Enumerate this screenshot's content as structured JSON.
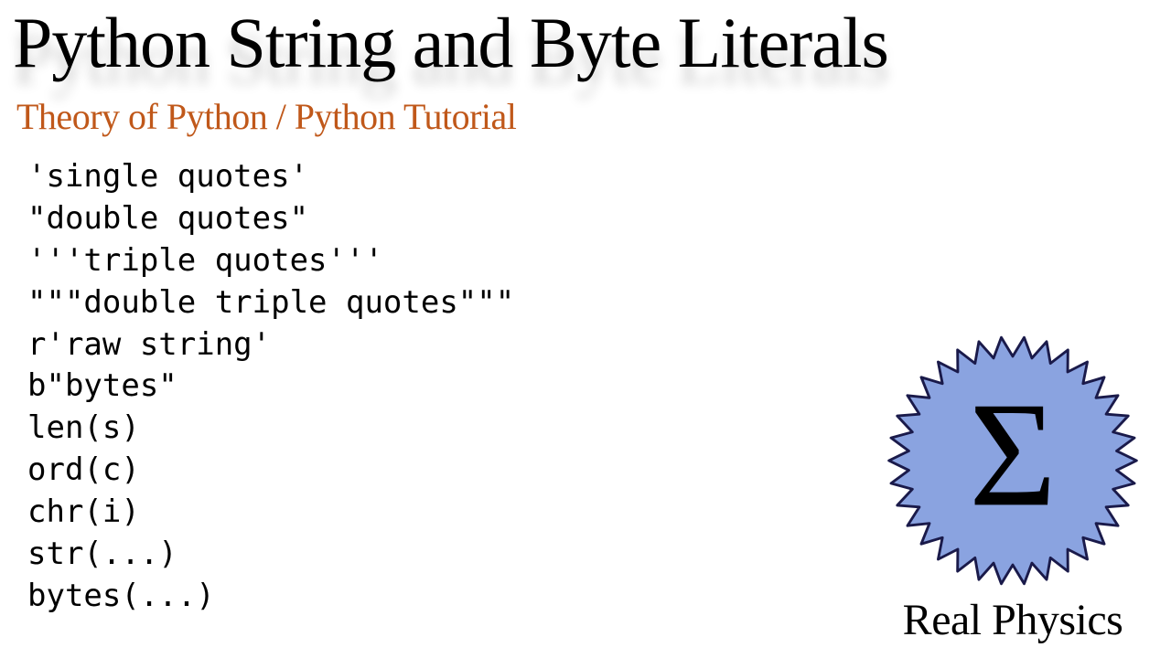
{
  "title": "Python String and Byte Literals",
  "subtitle": "Theory of Python / Python Tutorial",
  "code_lines": [
    "'single quotes'",
    "\"double quotes\"",
    "'''triple quotes'''",
    "\"\"\"double triple quotes\"\"\"",
    "r'raw string'",
    "b\"bytes\"",
    "len(s)",
    "ord(c)",
    "chr(i)",
    "str(...)",
    "bytes(...)"
  ],
  "logo": {
    "symbol": "Σ",
    "brand": "Real Physics",
    "fill": "#8aa3e0",
    "stroke": "#1a1a4a"
  }
}
